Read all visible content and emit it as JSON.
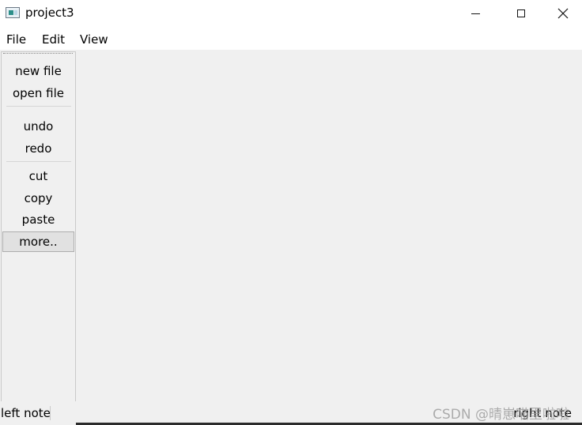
{
  "window": {
    "title": "project3",
    "controls": {
      "minimize": "minimize",
      "maximize": "maximize",
      "close": "×"
    }
  },
  "menubar": {
    "items": [
      {
        "label": "File"
      },
      {
        "label": "Edit"
      },
      {
        "label": "View"
      }
    ]
  },
  "toolbar": {
    "items": [
      {
        "label": "new file"
      },
      {
        "label": "open file"
      },
      {
        "label": "undo"
      },
      {
        "label": "redo"
      },
      {
        "label": "cut"
      },
      {
        "label": "copy"
      },
      {
        "label": "paste"
      },
      {
        "label": "more.."
      }
    ],
    "active_item": "more.."
  },
  "statusbar": {
    "left_note": "left note",
    "right_note": "right note"
  },
  "watermark": "CSDN @晴崽喵里啦啦",
  "colors": {
    "background": "#f0f0f0",
    "titlebar": "#ffffff",
    "active_button": "#e1e1e1"
  }
}
